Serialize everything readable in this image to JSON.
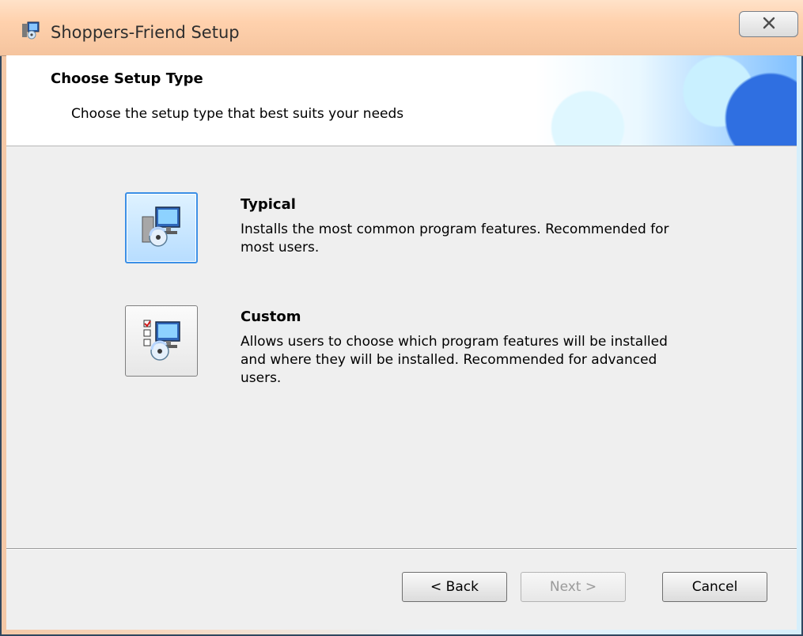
{
  "window": {
    "title": "Shoppers-Friend Setup"
  },
  "banner": {
    "title": "Choose Setup Type",
    "subtitle": "Choose the setup type that best suits your needs"
  },
  "options": [
    {
      "heading": "Typical",
      "description_lines": [
        "Installs the most common program features. Recommended for",
        "most users."
      ]
    },
    {
      "heading": "Custom",
      "description_lines": [
        "Allows users to choose which program features will be installed",
        "and where they will be installed. Recommended for advanced",
        "users."
      ]
    }
  ],
  "buttons": {
    "back": "< Back",
    "next": "Next >",
    "cancel": "Cancel"
  },
  "icons": {
    "app": "installer-app-icon",
    "close": "close-icon",
    "typical": "typical-install-icon",
    "custom": "custom-install-icon"
  }
}
